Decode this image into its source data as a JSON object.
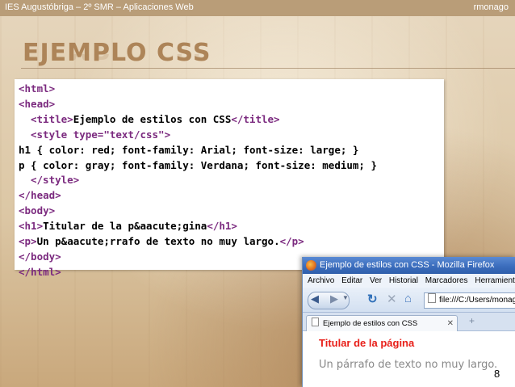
{
  "header": {
    "left_text": "IES Augustóbriga – 2º SMR – Aplicaciones Web",
    "right_text": "rmonago"
  },
  "slide": {
    "title": "EJEMPLO CSS",
    "number": "8"
  },
  "code": {
    "line1": "<html>",
    "line2": "<head>",
    "line3_open": "<title>",
    "line3_text": "Ejemplo de estilos con CSS",
    "line3_close": "</title>",
    "line4_tag_open": "<style ",
    "line4_attr": "type=\"text/css\"",
    "line4_tag_close": ">",
    "line5": "h1 { color: red; font-family: Arial; font-size: large; }",
    "line6": "p { color: gray; font-family: Verdana; font-size: medium; }",
    "line7": "</style>",
    "line8": "</head>",
    "line9": "<body>",
    "line10_open": "<h1>",
    "line10_text": "Titular de la p&aacute;gina",
    "line10_close": "</h1>",
    "line11_open": "<p>",
    "line11_text": "Un p&aacute;rrafo de texto no muy largo.",
    "line11_close": "</p>",
    "line12": "</body>",
    "line13": "</html>"
  },
  "browser": {
    "window_title": "Ejemplo de estilos con CSS - Mozilla Firefox",
    "menu": {
      "archivo": "Archivo",
      "editar": "Editar",
      "ver": "Ver",
      "historial": "Historial",
      "marcadores": "Marcadores",
      "herramientas": "Herramientas"
    },
    "url": "file:///C:/Users/monago",
    "tab_label": "Ejemplo de estilos con CSS",
    "page": {
      "heading": "Titular de la página",
      "paragraph": "Un párrafo de texto no muy largo."
    }
  },
  "icons": {
    "back": "arrow-left-icon",
    "forward": "arrow-right-icon",
    "reload": "reload-icon",
    "stop": "stop-icon",
    "home": "home-icon",
    "firefox": "firefox-logo-icon"
  }
}
